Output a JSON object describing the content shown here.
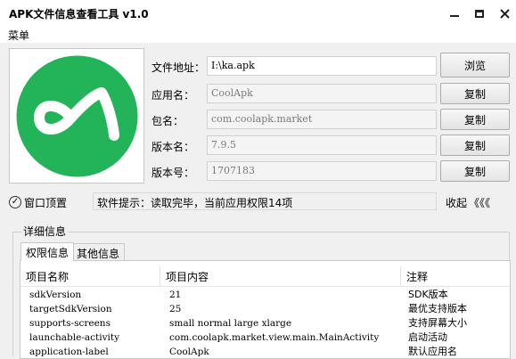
{
  "window": {
    "title": "APK文件信息查看工具 v1.0",
    "controls": [
      "minimize",
      "maximize",
      "close"
    ]
  },
  "menu": {
    "label": "菜单"
  },
  "logo": {
    "icon": "coolapk-logo-icon",
    "bg_color": "#23b45a",
    "mark_color": "#ffffff"
  },
  "fields": {
    "file_path": {
      "label": "文件地址：",
      "value": "I:\\ka.apk",
      "button": "浏览"
    },
    "app_name": {
      "label": "应用名：",
      "value": "CoolApk",
      "button": "复制"
    },
    "package": {
      "label": "包名：",
      "value": "com.coolapk.market",
      "button": "复制"
    },
    "version_name": {
      "label": "版本名：",
      "value": "7.9.5",
      "button": "复制"
    },
    "version_code": {
      "label": "版本号：",
      "value": "1707183",
      "button": "复制"
    }
  },
  "options": {
    "pin_window": "窗口顶置",
    "hint": "软件提示：读取完毕，当前应用权限14项",
    "collapse": "收起",
    "collapse_glyph": "《《《"
  },
  "details": {
    "group_title": "详细信息",
    "tabs": [
      "权限信息",
      "其他信息"
    ],
    "columns": [
      "项目名称",
      "项目内容",
      "注释"
    ],
    "rows": [
      [
        "sdkVersion",
        "21",
        "SDK版本"
      ],
      [
        "targetSdkVersion",
        "25",
        "最优支持版本"
      ],
      [
        "supports-screens",
        "small normal large xlarge",
        "支持屏幕大小"
      ],
      [
        "launchable-activity",
        "com.coolapk.market.view.main.MainActivity",
        "启动活动"
      ],
      [
        "application-label",
        "CoolApk",
        "默认应用名"
      ]
    ]
  }
}
